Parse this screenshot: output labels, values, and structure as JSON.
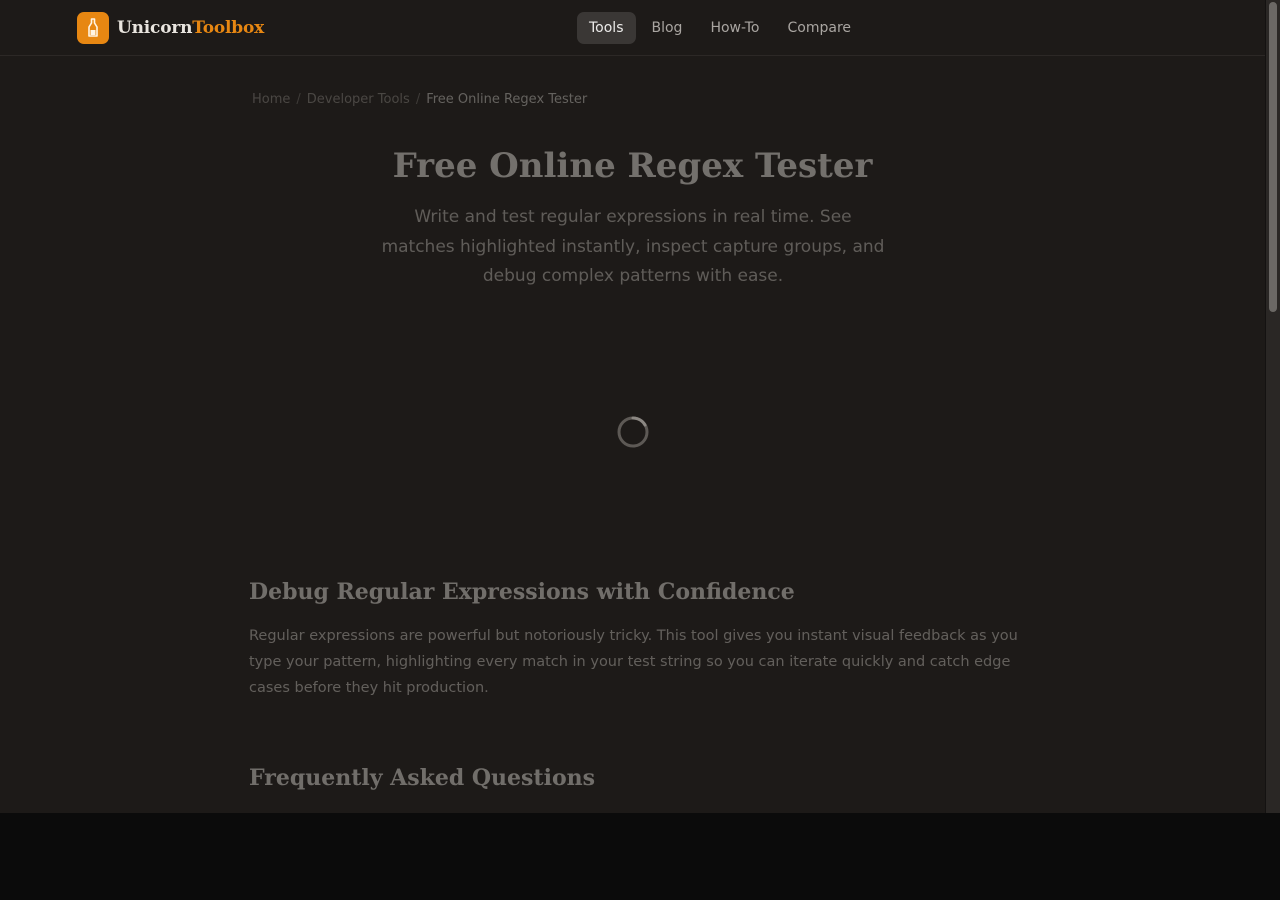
{
  "brand": {
    "name_part1": "Unicorn",
    "name_part2": "Toolbox",
    "logo_icon": "bottle-icon",
    "accent": "#e78712"
  },
  "nav": {
    "items": [
      {
        "label": "Tools",
        "active": true
      },
      {
        "label": "Blog",
        "active": false
      },
      {
        "label": "How-To",
        "active": false
      },
      {
        "label": "Compare",
        "active": false
      }
    ]
  },
  "breadcrumb": {
    "items": [
      "Home",
      "Developer Tools"
    ],
    "current": "Free Online Regex Tester",
    "separator": "/"
  },
  "hero": {
    "title": "Free Online Regex Tester",
    "subtitle": "Write and test regular expressions in real time. See matches highlighted instantly, inspect capture groups, and debug complex patterns with ease."
  },
  "loading": {
    "icon": "spinner-icon"
  },
  "sections": {
    "debug": {
      "heading": "Debug Regular Expressions with Confidence",
      "body": "Regular expressions are powerful but notoriously tricky. This tool gives you instant visual feedback as you type your pattern, highlighting every match in your test string so you can iterate quickly and catch edge cases before they hit production."
    },
    "faq": {
      "heading": "Frequently Asked Questions"
    }
  }
}
